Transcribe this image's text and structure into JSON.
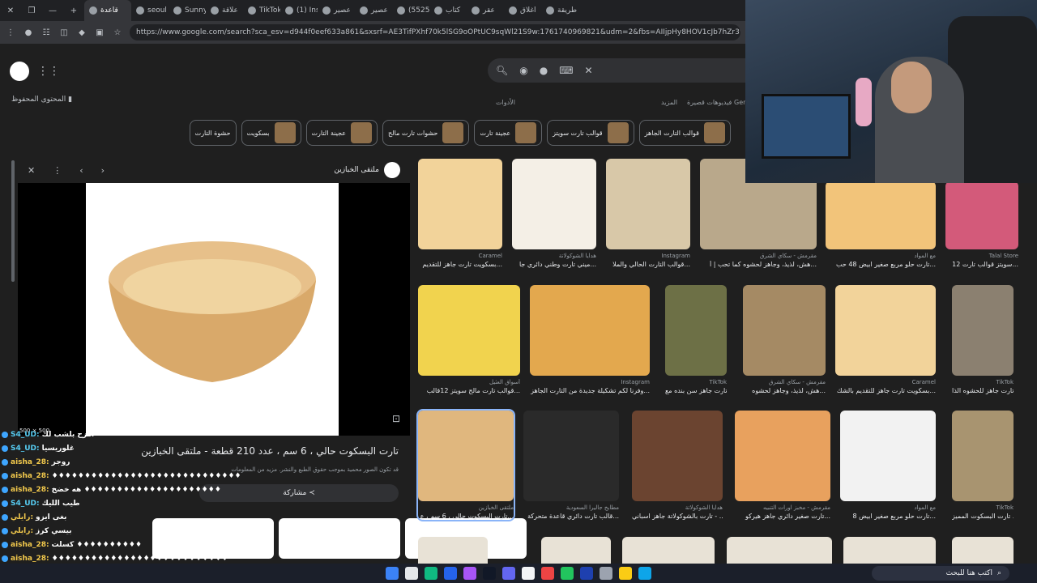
{
  "browser": {
    "tabs": [
      {
        "label": "طريقة"
      },
      {
        "label": "اغلاق"
      },
      {
        "label": "عقر"
      },
      {
        "label": "كتاب"
      },
      {
        "label": "(5525)"
      },
      {
        "label": "عصير"
      },
      {
        "label": "عصير"
      },
      {
        "label": "(1) Ins"
      },
      {
        "label": "TikTok"
      },
      {
        "label": "علاقة"
      },
      {
        "label": "Sunny"
      },
      {
        "label": "seoul"
      },
      {
        "label": "قاعدة"
      }
    ],
    "url": "https://www.google.com/search?sca_esv=d944f0eef633a861&sxsrf=AE3TifPXhf70k5lSG9oOPtUC9sqWl21S9w:1761740969821&udm=2&fbs=AIIjpHy8HOV1cJb7hZr3WhGJXlOxfkVJh81XRwO1R"
  },
  "google": {
    "saved_label": "المحتوى المحفوظ",
    "filters": [
      "Gen",
      "فيديوهات قصيرة",
      "المزيد",
      "الأدوات"
    ],
    "chips": [
      {
        "label": "قوالب التارت الجاهز"
      },
      {
        "label": "قوالب تارت سويتز"
      },
      {
        "label": "عجينة تارت"
      },
      {
        "label": "حشوات تارت مالح"
      },
      {
        "label": "عجينة التارت"
      },
      {
        "label": "بسكويت"
      },
      {
        "label": "حشوة التارت"
      }
    ]
  },
  "preview": {
    "source": "ملتقى الخبازين",
    "title": "تارت البسكوت حالي ، 6 سم ، عدد 210 قطعة - ملتقى الخبازين",
    "note": "قد تكون الصور محمية بموجب حقوق الطبع والنشر. مزيد من المعلومات",
    "share_label": "مشاركة",
    "dimensions": "500 × 500"
  },
  "results": [
    {
      "source": "Caramel",
      "caption": "بسكويت تارت جاهز للتقديم...",
      "color": "#f2d39a"
    },
    {
      "source": "هدايا الشوكولاتة",
      "caption": "ميني تارت وطني دائري جا...",
      "color": "#f4efe6"
    },
    {
      "source": "Instagram",
      "caption": "قوالب التارت الحالي والملا...",
      "color": "#d8c8a8"
    },
    {
      "source": "مقرمش - سكاي الشرق",
      "caption": "هش، لذيذ، وجاهز لحشوه كما تحب | أ...",
      "color": "#b9a88b"
    },
    {
      "source": "مع المواد",
      "caption": "تارت حلو مربع صغير ابيض 48 حب...",
      "color": "#f2c47a"
    },
    {
      "source": "Talal Store",
      "caption": "سويتز قوالب تارت 12...",
      "color": "#d35a7a"
    },
    {
      "source": "أسواق العثيل",
      "caption": "قوالب تارت مالح سويتز 12قالب...",
      "color": "#f1d34e"
    },
    {
      "source": "Instagram",
      "caption": "وفرنا لكم تشكيلة جديدة من التارت الجاهز...",
      "color": "#e3a84e"
    },
    {
      "source": "TikTok",
      "caption": "تارت جاهز سن بنده مع...",
      "color": "#6d7046"
    },
    {
      "source": "مقرمش - سكاي الشرق",
      "caption": "هش، لذيذ، وجاهز لحشوه...",
      "color": "#a58a64"
    },
    {
      "source": "Caramel",
      "caption": "بسكويت تارت جاهز للتقديم بالشك...",
      "color": "#f2d39a"
    },
    {
      "source": "TikTok",
      "caption": "تارت جاهز للحشوه الذا...",
      "color": "#8b8070"
    },
    {
      "source": "ملتقى الخبازين",
      "caption": "تارت البسكوت حالي ، 6 سم ، ع...",
      "color": "#e0b77e"
    },
    {
      "source": "مطابخ جاليرا السعودية",
      "caption": "قالب تارت دائري قاعدة متحركة...",
      "color": "#2a2a2a"
    },
    {
      "source": "هدايا الشوكولاتة",
      "caption": "تارت بالشوكولاتة جاهز اسباني - ...",
      "color": "#6b4430"
    },
    {
      "source": "مقرمش - مخبز اورات التنبيه",
      "caption": "تارت صغير دائري جاهز هيركو...",
      "color": "#e8a15e"
    },
    {
      "source": "مع المواد",
      "caption": "تارت حلو مربع صغير ابيض 8...",
      "color": "#f2f2f2"
    },
    {
      "source": "TikTok",
      "caption": "تارت البسكوت المميز ...",
      "color": "#a89470"
    }
  ],
  "chat": [
    {
      "user": "S4_UD",
      "text": "امزح بلشب لك",
      "blue": true
    },
    {
      "user": "S4_UD",
      "text": "غلوريسيا",
      "blue": true
    },
    {
      "user": "aisha_28",
      "text": "روجر",
      "blue": false
    },
    {
      "user": "aisha_28",
      "text": "♦♦♦♦♦♦♦♦♦♦♦♦♦♦♦♦♦♦♦♦♦♦♦♦♦♦♦♦♦",
      "blue": false
    },
    {
      "user": "aisha_28",
      "text": "هه خضخ ♦♦♦♦♦♦♦♦♦♦♦♦♦♦♦♦♦♦♦♦♦",
      "blue": false
    },
    {
      "user": "S4_UD",
      "text": "طيب الليك",
      "blue": true
    },
    {
      "user": "رايلي",
      "text": "بغى ايزو",
      "blue": false
    },
    {
      "user": "رايلي",
      "text": "بيسي كرز",
      "blue": false
    },
    {
      "user": "aisha_28",
      "text": "كسلت ♦♦♦♦♦♦♦♦♦♦",
      "blue": false
    },
    {
      "user": "aisha_28",
      "text": "♦♦♦♦♦♦♦♦♦♦♦♦♦♦♦♦♦♦♦♦♦♦♦♦♦♦♦",
      "blue": false
    }
  ],
  "taskbar": {
    "search_placeholder": "اكتب هنا للبحث"
  }
}
